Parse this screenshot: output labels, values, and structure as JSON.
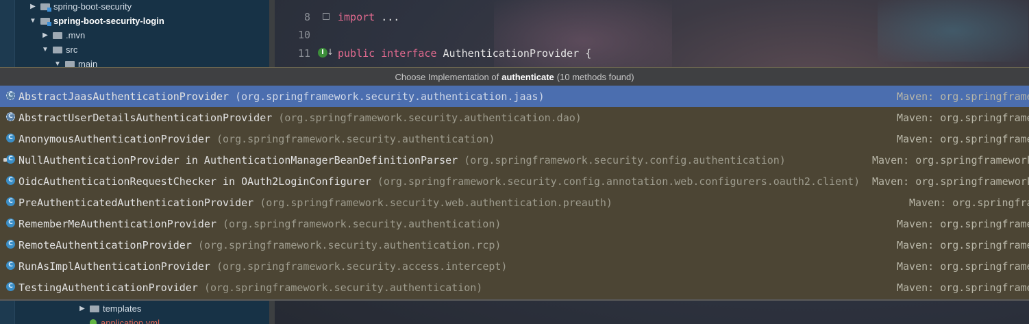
{
  "sidebar": {
    "items": [
      {
        "label": "spring-boot-security",
        "expanded": false,
        "bold": false
      },
      {
        "label": "spring-boot-security-login",
        "expanded": true,
        "bold": true
      },
      {
        "label": ".mvn",
        "expanded": false,
        "bold": false
      },
      {
        "label": "src",
        "expanded": true,
        "bold": false
      },
      {
        "label": "main",
        "expanded": true,
        "bold": false
      }
    ],
    "bottom_items": [
      {
        "label": "templates",
        "expanded": false
      },
      {
        "label": "application.yml"
      }
    ]
  },
  "editor": {
    "lines": [
      {
        "number": "8",
        "keyword": "import",
        "text": " ..."
      },
      {
        "number": "10",
        "keyword": "",
        "text": ""
      },
      {
        "number": "11",
        "keyword": "public interface",
        "text": " AuthenticationProvider {"
      }
    ]
  },
  "popup": {
    "title_prefix": "Choose Implementation of",
    "method": "authenticate",
    "title_suffix": "(10 methods found)",
    "selected_index": 0,
    "items": [
      {
        "name": "AbstractJaasAuthenticationProvider",
        "package": "(org.springframework.security.authentication.jaas)",
        "source": "Maven: org.springframe",
        "icon": "abstract-class-icon"
      },
      {
        "name": "AbstractUserDetailsAuthenticationProvider",
        "package": "(org.springframework.security.authentication.dao)",
        "source": "Maven: org.springframe",
        "icon": "abstract-class-icon"
      },
      {
        "name": "AnonymousAuthenticationProvider",
        "package": "(org.springframework.security.authentication)",
        "source": "Maven: org.springframe",
        "icon": "class-icon"
      },
      {
        "name": "NullAuthenticationProvider in AuthenticationManagerBeanDefinitionParser",
        "package": "(org.springframework.security.config.authentication)",
        "source": "Maven: org.springframework",
        "icon": "inner-class-icon"
      },
      {
        "name": "OidcAuthenticationRequestChecker in OAuth2LoginConfigurer",
        "package": "(org.springframework.security.config.annotation.web.configurers.oauth2.client)",
        "source": "Maven: org.springframework",
        "icon": "class-icon"
      },
      {
        "name": "PreAuthenticatedAuthenticationProvider",
        "package": "(org.springframework.security.web.authentication.preauth)",
        "source": "Maven: org.springfra",
        "icon": "class-icon"
      },
      {
        "name": "RememberMeAuthenticationProvider",
        "package": "(org.springframework.security.authentication)",
        "source": "Maven: org.springframe",
        "icon": "class-icon"
      },
      {
        "name": "RemoteAuthenticationProvider",
        "package": "(org.springframework.security.authentication.rcp)",
        "source": "Maven: org.springframe",
        "icon": "class-icon"
      },
      {
        "name": "RunAsImplAuthenticationProvider",
        "package": "(org.springframework.security.access.intercept)",
        "source": "Maven: org.springframe",
        "icon": "class-icon"
      },
      {
        "name": "TestingAuthenticationProvider",
        "package": "(org.springframework.security.authentication)",
        "source": "Maven: org.springframe",
        "icon": "class-icon"
      }
    ]
  },
  "colors": {
    "selection": "#4b6eaf",
    "popup_background": "#4c4534",
    "keyword": "#e26a8f",
    "class_icon": "#3b8ec6"
  }
}
